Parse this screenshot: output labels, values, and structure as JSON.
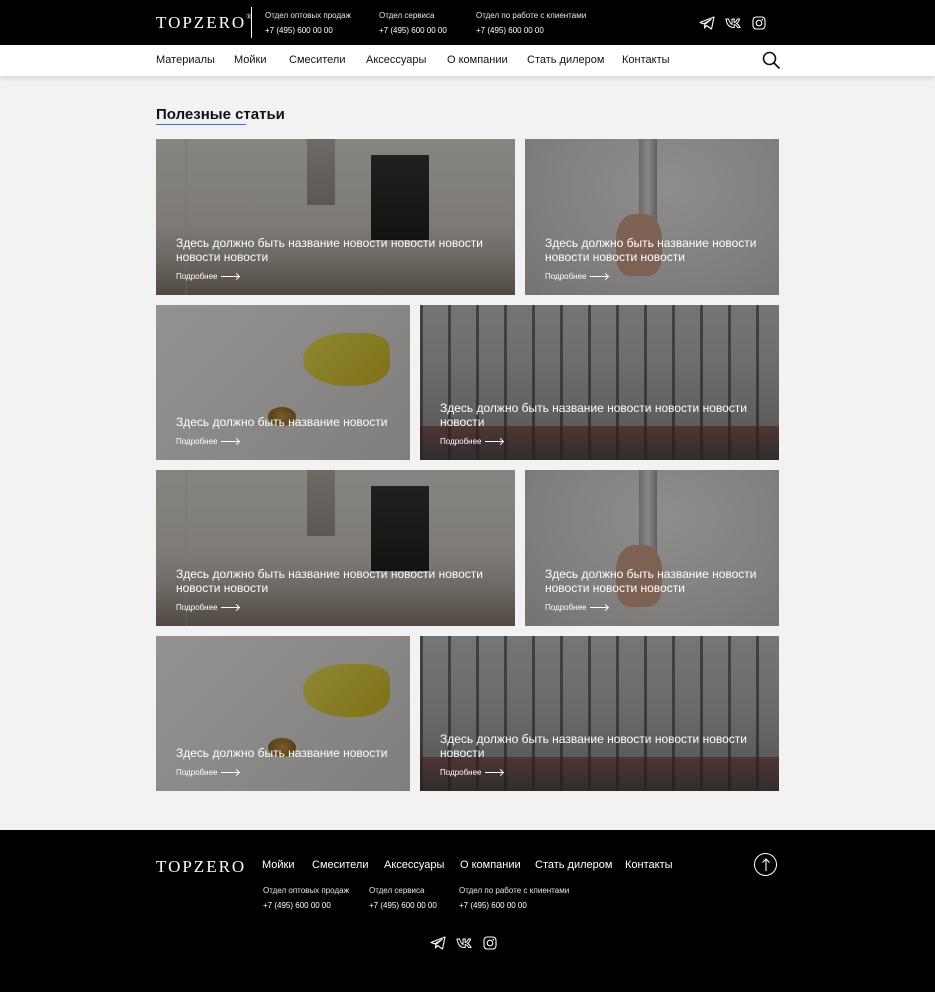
{
  "brand": {
    "logo_text": "TOPZERO",
    "logo_mark": "®"
  },
  "header": {
    "contacts": [
      {
        "label": "Отдел оптовых продаж",
        "phone": "+7 (495) 600 00 00"
      },
      {
        "label": "Отдел сервиса",
        "phone": "+7 (495) 600 00 00"
      },
      {
        "label": "Отдел по работе с клиентами",
        "phone": "+7 (495) 600 00 00"
      }
    ],
    "social_icons": [
      "telegram-icon",
      "vk-icon",
      "instagram-icon"
    ]
  },
  "nav": {
    "items": [
      "Материалы",
      "Мойки",
      "Смесители",
      "Аксессуары",
      "О компании",
      "Стать дилером",
      "Контакты"
    ],
    "search_icon": "search-icon"
  },
  "section": {
    "title": "Полезные статьи"
  },
  "cards": [
    {
      "title": "Здесь должно быть название новости новости новости новости новости",
      "more": "Подробнее",
      "image": "kitchen"
    },
    {
      "title": "Здесь должно быть название новости новости новости новости",
      "more": "Подробнее",
      "image": "hands"
    },
    {
      "title": "Здесь должно быть название новости",
      "more": "Подробнее",
      "image": "sink"
    },
    {
      "title": "Здесь должно быть название новости новости новости новости",
      "more": "Подробнее",
      "image": "hall"
    },
    {
      "title": "Здесь должно быть название новости новости новости новости новости",
      "more": "Подробнее",
      "image": "kitchen"
    },
    {
      "title": "Здесь должно быть название новости новости новости новости",
      "more": "Подробнее",
      "image": "hands"
    },
    {
      "title": "Здесь должно быть название новости",
      "more": "Подробнее",
      "image": "sink"
    },
    {
      "title": "Здесь должно быть название новости новости новости новости",
      "more": "Подробнее",
      "image": "hall"
    }
  ],
  "footer": {
    "nav": [
      "Мойки",
      "Смесители",
      "Аксессуары",
      "О компании",
      "Стать дилером",
      "Контакты"
    ],
    "contacts": [
      {
        "label": "Отдел оптовых продаж",
        "phone": "+7 (495) 600 00 00"
      },
      {
        "label": "Отдел сервиса",
        "phone": "+7 (495) 600 00 00"
      },
      {
        "label": "Отдел по работе с клиентами",
        "phone": "+7 (495) 600 00 00"
      }
    ],
    "up_icon": "arrow-up-icon"
  }
}
